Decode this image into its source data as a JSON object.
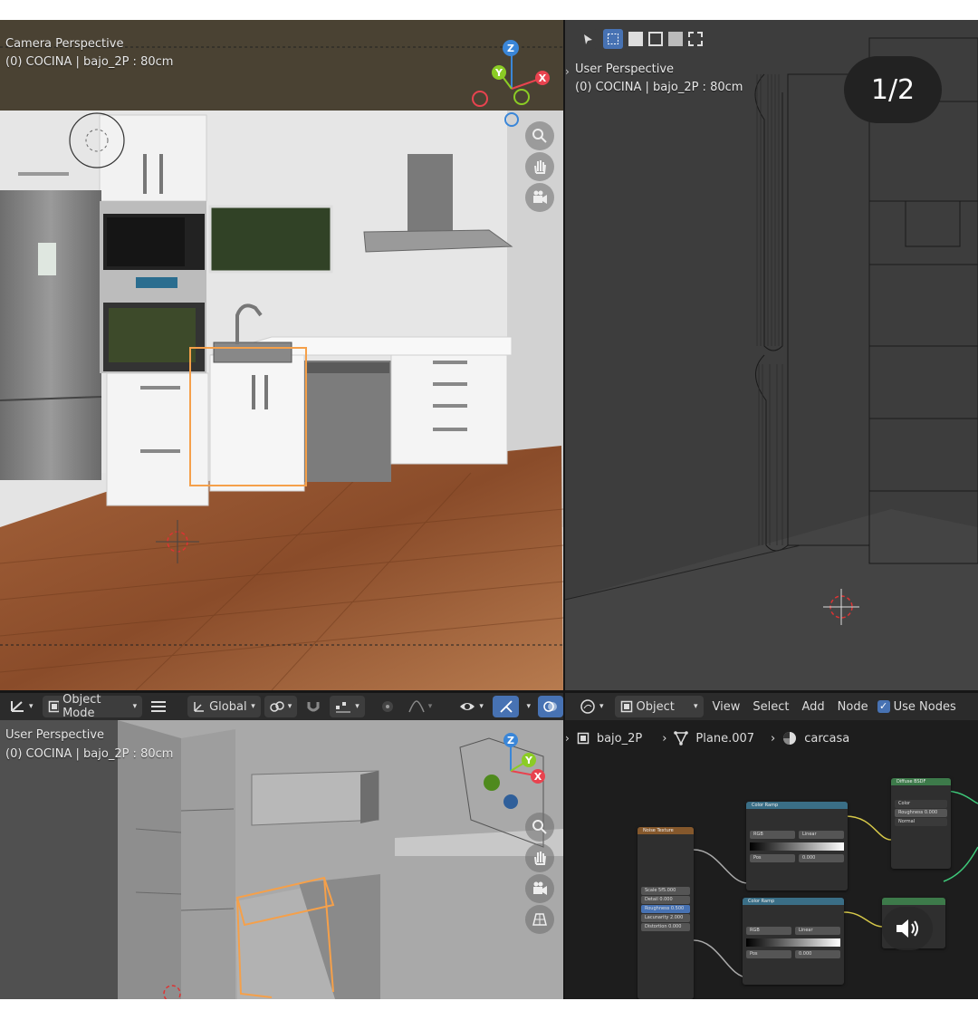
{
  "top_left_viewport": {
    "view_name": "Camera Perspective",
    "object_info": "(0) COCINA | bajo_2P : 80cm",
    "gizmo": {
      "z": "Z",
      "y": "Y",
      "x": "X"
    }
  },
  "top_right_viewport": {
    "view_name": "User Perspective",
    "object_info": "(0) COCINA | bajo_2P : 80cm",
    "page_badge": "1/2"
  },
  "viewport_header": {
    "mode_label": "Object Mode",
    "transform_label": "Global"
  },
  "bottom_left_viewport": {
    "view_name": "User Perspective",
    "object_info": "(0) COCINA | bajo_2P : 80cm",
    "gizmo": {
      "z": "Z",
      "y": "Y",
      "x": "X"
    }
  },
  "node_editor": {
    "header": {
      "object_dropdown": "Object",
      "menu": [
        "View",
        "Select",
        "Add",
        "Node"
      ],
      "use_nodes_label": "Use Nodes"
    },
    "breadcrumb": {
      "object": "bajo_2P",
      "mesh": "Plane.007",
      "material": "carcasa"
    },
    "nodes": {
      "noise_texture": {
        "title": "Noise Texture",
        "scale": "Scale   5f5.000",
        "detail": "Detail   0.000",
        "roughness": "Roughness  0.500",
        "lacunarity": "Lacunarity  2.000",
        "distortion": "Distortion  0.000"
      },
      "color_ramp_1": {
        "title": "Color Ramp",
        "rgb": "RGB",
        "linear": "Linear",
        "pos": "Pos",
        "val": "0.000"
      },
      "color_ramp_2": {
        "title": "Color Ramp",
        "rgb": "RGB",
        "linear": "Linear",
        "pos": "Pos",
        "val": "0.000"
      },
      "diffuse": {
        "title": "Diffuse BSDF",
        "color": "Color",
        "roughness": "Roughness 0.000",
        "normal": "Normal"
      }
    }
  },
  "colors": {
    "accent_blue": "#4772b3",
    "selection_orange": "#f5a04a",
    "axis_x": "#e8434f",
    "axis_y": "#8bcc25",
    "axis_z": "#3a86d8"
  }
}
